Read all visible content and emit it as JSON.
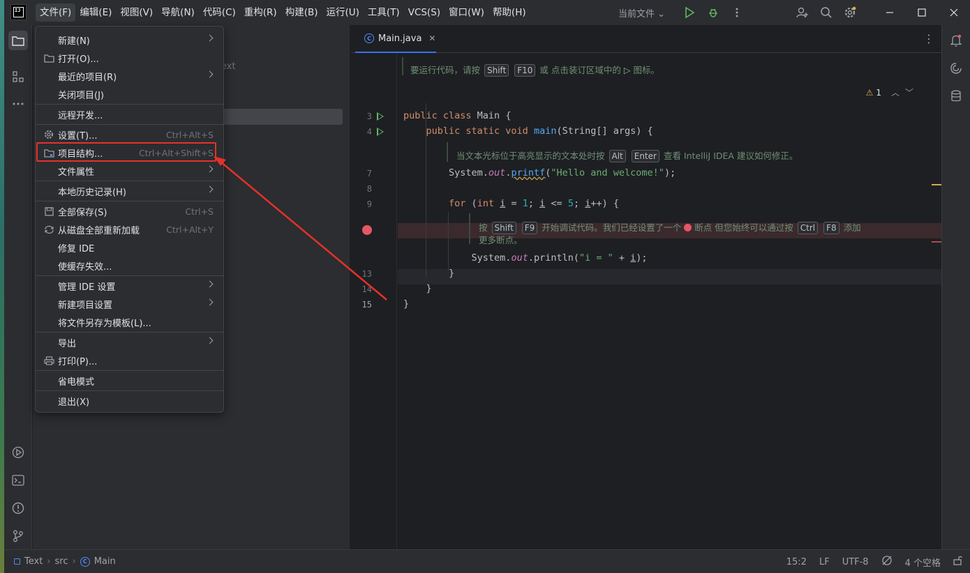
{
  "menubar": {
    "items": [
      "文件(F)",
      "编辑(E)",
      "视图(V)",
      "导航(N)",
      "代码(C)",
      "重构(R)",
      "构建(B)",
      "运行(U)",
      "工具(T)",
      "VCS(S)",
      "窗口(W)",
      "帮助(H)"
    ]
  },
  "toolbar": {
    "run_config": "当前文件 ⌄"
  },
  "project_panel": {
    "ghost_text": "ext"
  },
  "editor": {
    "tab_name": "Main.java",
    "warning_count": "1",
    "line_numbers": [
      "3",
      "4",
      "7",
      "8",
      "9",
      "13",
      "14",
      "15"
    ],
    "hint1": {
      "pre": "要运行代码，请按",
      "k1": "Shift",
      "k2": "F10",
      "mid": "或 点击装订区域中的",
      "post": "图标。"
    },
    "hint2": {
      "pre": "当文本光标位于高亮显示的文本处时按",
      "k1": "Alt",
      "k2": "Enter",
      "post": "查看 IntelliJ IDEA 建议如何修正。"
    },
    "hint3": {
      "pre": "按",
      "k1": "Shift",
      "k2": "F9",
      "mid": "开始调试代码。我们已经设置了一个",
      "mid2": "断点 但您始终可以通过按",
      "k3": "Ctrl",
      "k4": "F8",
      "post": "添加",
      "line2": "更多断点。"
    }
  },
  "file_menu": {
    "items": [
      {
        "label": "新建(N)",
        "shortcut": "",
        "submenu": true
      },
      {
        "label": "打开(O)...",
        "shortcut": "",
        "submenu": false
      },
      {
        "label": "最近的项目(R)",
        "shortcut": "",
        "submenu": true
      },
      {
        "label": "关闭项目(J)",
        "shortcut": "",
        "submenu": false
      },
      {
        "label": "远程开发...",
        "shortcut": "",
        "submenu": false
      },
      {
        "label": "设置(T)...",
        "shortcut": "Ctrl+Alt+S",
        "submenu": false
      },
      {
        "label": "项目结构...",
        "shortcut": "Ctrl+Alt+Shift+S",
        "submenu": false
      },
      {
        "label": "文件属性",
        "shortcut": "",
        "submenu": true
      },
      {
        "label": "本地历史记录(H)",
        "shortcut": "",
        "submenu": true
      },
      {
        "label": "全部保存(S)",
        "shortcut": "Ctrl+S",
        "submenu": false
      },
      {
        "label": "从磁盘全部重新加载",
        "shortcut": "Ctrl+Alt+Y",
        "submenu": false
      },
      {
        "label": "修复 IDE",
        "shortcut": "",
        "submenu": false
      },
      {
        "label": "使缓存失效...",
        "shortcut": "",
        "submenu": false
      },
      {
        "label": "管理 IDE 设置",
        "shortcut": "",
        "submenu": true
      },
      {
        "label": "新建项目设置",
        "shortcut": "",
        "submenu": true
      },
      {
        "label": "将文件另存为模板(L)...",
        "shortcut": "",
        "submenu": false
      },
      {
        "label": "导出",
        "shortcut": "",
        "submenu": true
      },
      {
        "label": "打印(P)...",
        "shortcut": "",
        "submenu": false
      },
      {
        "label": "省电模式",
        "shortcut": "",
        "submenu": false
      },
      {
        "label": "退出(X)",
        "shortcut": "",
        "submenu": false
      }
    ]
  },
  "statusbar": {
    "crumbs": [
      "Text",
      "src",
      "Main"
    ],
    "position": "15:2",
    "line_sep": "LF",
    "encoding": "UTF-8",
    "indent": "4 个空格"
  },
  "colors": {
    "accent": "#3574f0",
    "highlight": "#e5312b",
    "breakpoint": "#e55765"
  }
}
